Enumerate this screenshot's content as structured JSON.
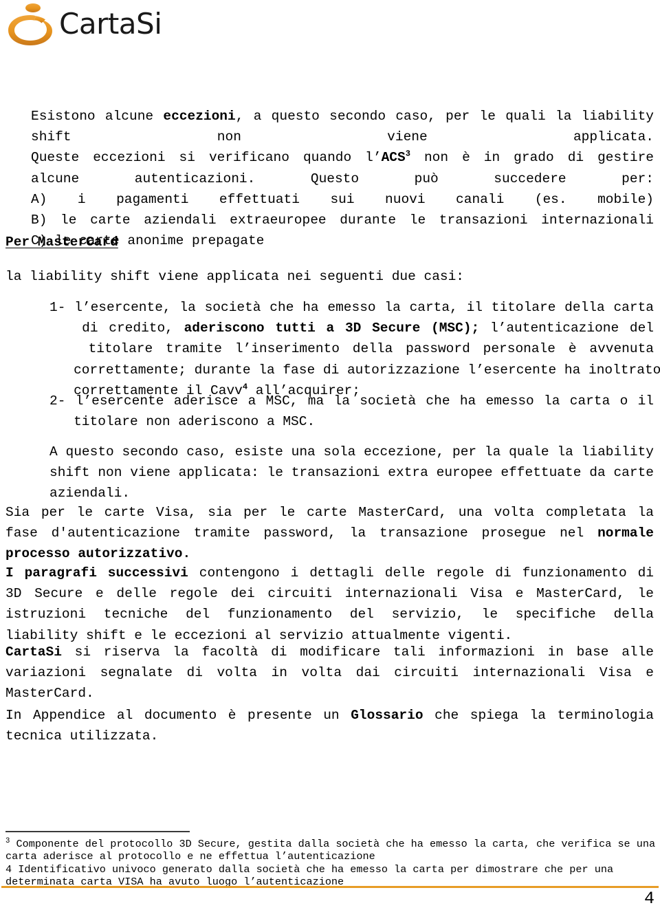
{
  "header": {
    "logo_icon": "cartasi-logo-icon",
    "brand": "CartaSi",
    "brand_color": "#E7941E"
  },
  "document": {
    "paragraphs": [
      {
        "id": "p-eccezioni",
        "lines": [
          [
            {
              "t": "Esistono alcune "
            },
            {
              "t": "eccezioni",
              "bold": true
            },
            {
              "t": ", a questo secondo caso, per le quali la liability"
            }
          ],
          [
            {
              "t": "shift non viene applicata."
            }
          ],
          [
            {
              "t": "Queste eccezioni si verificano quando l’"
            },
            {
              "t": "ACS",
              "bold": true
            },
            {
              "t": "3",
              "sup": true
            },
            {
              "t": " non è in grado di gestire"
            }
          ],
          [
            {
              "t": "alcune autenticazioni. Questo può succedere per:"
            }
          ],
          [
            {
              "t": "A) i pagamenti effettuati sui nuovi canali (es. mobile)"
            }
          ],
          [
            {
              "t": "B) le carte aziendali extraeuropee durante le transazioni internazionali"
            }
          ],
          [
            {
              "t": "C) le carte anonime prepagate"
            }
          ]
        ]
      },
      {
        "id": "p-per-mastercard",
        "lines": [
          [
            {
              "t": "Per MasterCard",
              "heading": true
            }
          ]
        ]
      },
      {
        "id": "p-liability-due-casi",
        "lines": [
          [
            {
              "t": "la liability shift viene applicata nei seguenti due casi:"
            }
          ]
        ]
      },
      {
        "id": "p-caso-1",
        "lines": [
          [
            {
              "t": "1- l’esercente, la società che ha emesso la carta, il titolare della carta"
            }
          ],
          [
            {
              "t": "   di credito, "
            },
            {
              "t": "aderiscono tutti a 3D Secure (MSC);",
              "bold": true
            },
            {
              "t": " l’autenticazione del"
            }
          ],
          [
            {
              "t": "   titolare tramite l’inserimento della password personale è avvenuta"
            }
          ],
          [
            {
              "t": "   correttamente; durante la fase di autorizzazione l’esercente ha inoltrato"
            }
          ],
          [
            {
              "t": "   correttamente il Cavv"
            },
            {
              "t": "4",
              "sup": true
            },
            {
              "t": " all’acquirer;"
            }
          ]
        ]
      },
      {
        "id": "p-caso-2",
        "lines": [
          [
            {
              "t": "2- l’esercente aderisce a MSC, ma la società che ha emesso la carta o il"
            }
          ],
          [
            {
              "t": "   titolare non aderiscono a MSC."
            }
          ]
        ]
      },
      {
        "id": "p-eccezione-unica",
        "lines": [
          [
            {
              "t": "A questo secondo caso, esiste una sola eccezione, per la quale la liability"
            }
          ],
          [
            {
              "t": "shift non viene applicata: le transazioni extra europee effettuate da carte"
            }
          ],
          [
            {
              "t": "aziendali."
            }
          ]
        ]
      },
      {
        "id": "p-visa-mastercard",
        "lines": [
          [
            {
              "t": "Sia per le carte Visa, sia per le carte MasterCard, una volta completata la"
            }
          ],
          [
            {
              "t": "fase d'autenticazione tramite password, la transazione prosegue nel "
            },
            {
              "t": "normale",
              "bold": true
            }
          ],
          [
            {
              "t": "processo autorizzativo.",
              "bold": true
            }
          ]
        ]
      },
      {
        "id": "p-paragrafi-successivi",
        "lines": [
          [
            {
              "t": "I paragrafi successivi",
              "bold": true
            },
            {
              "t": " contengono i dettagli delle regole di funzionamento di"
            }
          ],
          [
            {
              "t": "3D Secure e delle regole dei circuiti internazionali Visa e MasterCard, le"
            }
          ],
          [
            {
              "t": "istruzioni tecniche del funzionamento del servizio, le specifiche della"
            }
          ],
          [
            {
              "t": "liability shift e le eccezioni al servizio attualmente vigenti."
            }
          ]
        ]
      },
      {
        "id": "p-cartasi-riserva",
        "lines": [
          [
            {
              "t": "CartaSi",
              "bold": true
            },
            {
              "t": " si riserva la facoltà di modificare tali informazioni in base alle"
            }
          ],
          [
            {
              "t": "variazioni segnalate di volta in volta dai circuiti internazionali Visa e"
            }
          ],
          [
            {
              "t": "MasterCard."
            }
          ]
        ]
      },
      {
        "id": "p-appendice",
        "lines": [
          [
            {
              "t": "In Appendice al documento è presente un "
            },
            {
              "t": "Glossario",
              "bold": true
            },
            {
              "t": " che spiega la terminologia"
            }
          ],
          [
            {
              "t": "tecnica utilizzata."
            }
          ]
        ]
      }
    ],
    "footnotes": [
      {
        "marker": "3",
        "marker_superscript": true,
        "lines": [
          "Componente del protocollo 3D Secure, gestita dalla società che ha emesso la carta, che verifica se una",
          "carta aderisce al protocollo e ne effettua l’autenticazione"
        ]
      },
      {
        "marker": "4",
        "marker_superscript": false,
        "lines": [
          "Identificativo univoco generato dalla società che ha emesso la carta per dimostrare che per una",
          "determinata carta VISA ha avuto luogo l’autenticazione"
        ]
      }
    ],
    "footer": {
      "page_number": "4",
      "rule_color": "#E79C27"
    }
  }
}
